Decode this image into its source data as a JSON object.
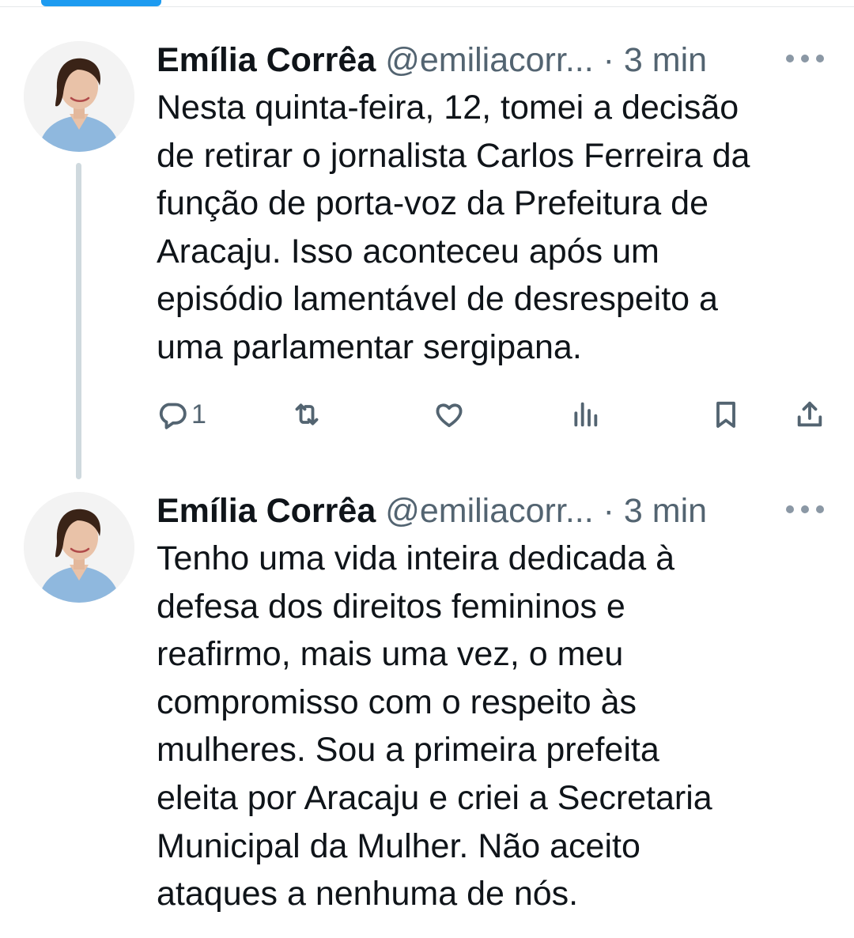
{
  "tweets": [
    {
      "author_name": "Emília Corrêa",
      "author_handle": "@emiliacorr...",
      "separator": "·",
      "timestamp": "3 min",
      "text": "Nesta quinta-feira, 12, tomei a decisão\nde retirar o jornalista Carlos Ferreira da\nfunção de porta-voz da Prefeitura de\nAracaju. Isso aconteceu após um\nepisódio lamentável de desrespeito a\numa parlamentar sergipana.",
      "reply_count": "1",
      "icons": [
        "reply-icon",
        "retweet-icon",
        "like-icon",
        "views-icon",
        "bookmark-icon",
        "share-icon"
      ]
    },
    {
      "author_name": "Emília Corrêa",
      "author_handle": "@emiliacorr...",
      "separator": "·",
      "timestamp": "3 min",
      "text": "Tenho uma vida inteira dedicada à\ndefesa dos direitos femininos e\nreafirmo, mais uma vez, o meu\ncompromisso com o respeito às\nmulheres. Sou a primeira prefeita\neleita por Aracaju e criei a Secretaria\nMunicipal da Mulher. Não aceito\nataques a nenhuma de nós."
    }
  ],
  "colors": {
    "text_primary": "#0f1419",
    "text_secondary": "#536471",
    "thread_line": "#cfd9de",
    "accent": "#1d9bf0"
  }
}
